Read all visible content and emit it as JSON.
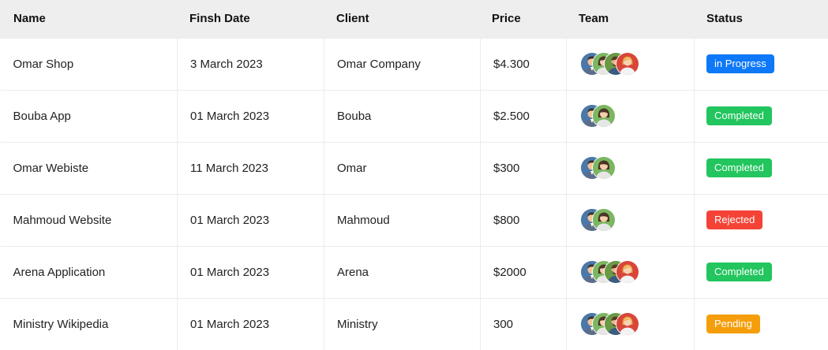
{
  "headers": {
    "name": "Name",
    "date": "Finsh Date",
    "client": "Client",
    "price": "Price",
    "team": "Team",
    "status": "Status"
  },
  "colors": {
    "in_progress": "#0d78f8",
    "completed": "#22c55e",
    "rejected": "#f44336",
    "pending": "#f59e0b"
  },
  "rows": [
    {
      "name": "Omar Shop",
      "date": "3 March 2023",
      "client": "Omar Company",
      "price": "$4.300",
      "team_size": 4,
      "status": "in Progress",
      "status_color": "#0d78f8"
    },
    {
      "name": "Bouba App",
      "date": "01 March 2023",
      "client": "Bouba",
      "price": "$2.500",
      "team_size": 2,
      "status": "Completed",
      "status_color": "#22c55e"
    },
    {
      "name": "Omar Webiste",
      "date": "11 March 2023",
      "client": "Omar",
      "price": "$300",
      "team_size": 2,
      "status": "Completed",
      "status_color": "#22c55e"
    },
    {
      "name": "Mahmoud Website",
      "date": "01 March 2023",
      "client": "Mahmoud",
      "price": "$800",
      "team_size": 2,
      "status": "Rejected",
      "status_color": "#f44336"
    },
    {
      "name": "Arena Application",
      "date": "01 March 2023",
      "client": "Arena",
      "price": "$2000",
      "team_size": 4,
      "status": "Completed",
      "status_color": "#22c55e"
    },
    {
      "name": "Ministry Wikipedia",
      "date": "01 March 2023",
      "client": "Ministry",
      "price": "300",
      "team_size": 4,
      "status": "Pending",
      "status_color": "#f59e0b"
    }
  ],
  "avatar_icons": [
    "avatar-man-icon",
    "avatar-woman-icon",
    "avatar-man-beard-icon",
    "avatar-woman-red-icon"
  ]
}
